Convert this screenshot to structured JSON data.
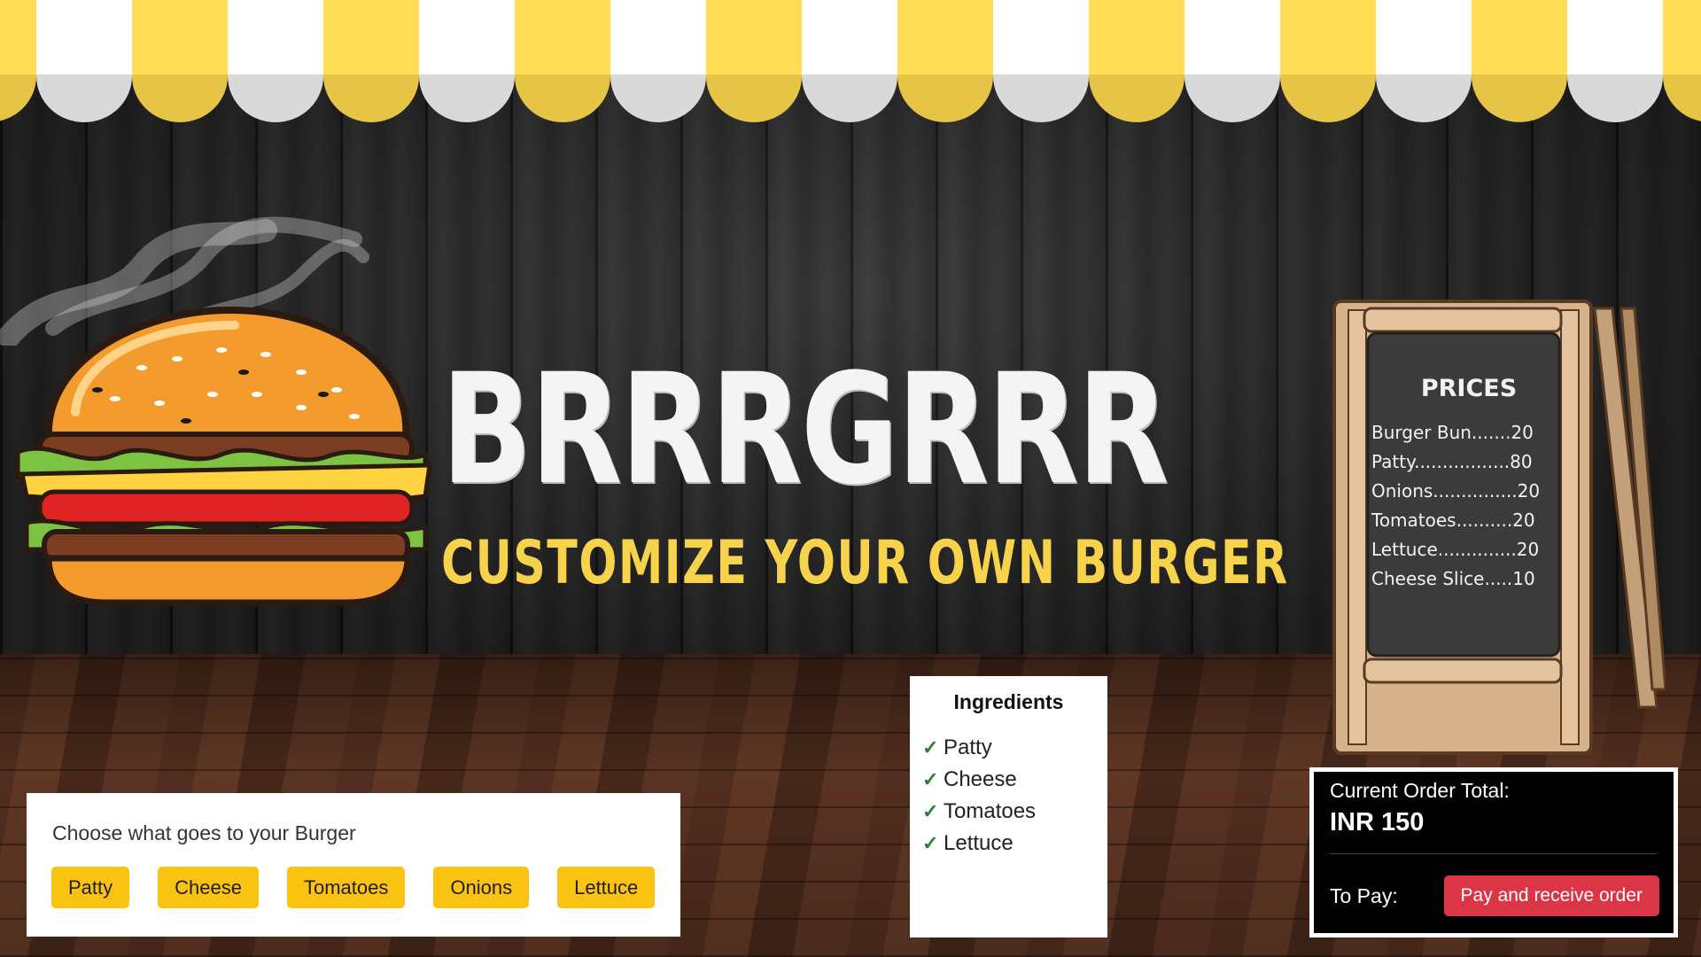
{
  "header": {
    "title": "BRRRGRRR",
    "subtitle": "CUSTOMIZE YOUR OWN BURGER"
  },
  "price_board": {
    "title": "PRICES",
    "items": [
      {
        "label": "Burger Bun.......20"
      },
      {
        "label": "Patty.................80"
      },
      {
        "label": "Onions...............20"
      },
      {
        "label": "Tomatoes..........20"
      },
      {
        "label": "Lettuce..............20"
      },
      {
        "label": "Cheese Slice.....10"
      }
    ]
  },
  "chooser": {
    "label": "Choose what goes to your Burger",
    "buttons": [
      "Patty",
      "Cheese",
      "Tomatoes",
      "Onions",
      "Lettuce"
    ]
  },
  "ingredients": {
    "title": "Ingredients",
    "check_glyph": "✓",
    "items": [
      "Patty",
      "Cheese",
      "Tomatoes",
      "Lettuce"
    ]
  },
  "order": {
    "total_label": "Current Order Total:",
    "total_value": "INR 150",
    "pay_label": "To Pay:",
    "pay_button": "Pay and receive order"
  },
  "colors": {
    "awning_yellow": "#ffdd55",
    "awning_white": "#ffffff",
    "title_white": "#f4f4f4",
    "subtitle_yellow": "#f6d34a",
    "button_yellow": "#fbc311",
    "pay_red": "#dc3545",
    "check_green": "#2e7d32"
  }
}
